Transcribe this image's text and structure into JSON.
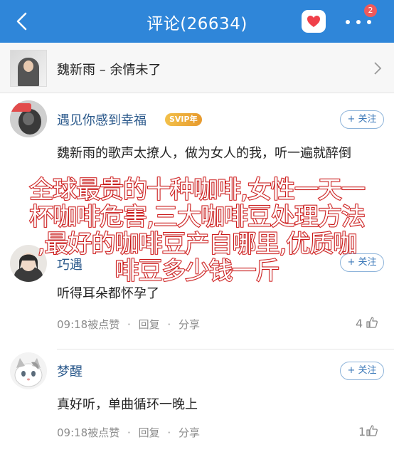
{
  "header": {
    "title": "评论(26634)",
    "notification_count": "2",
    "colors": {
      "bar": "#2f86d9",
      "badge": "#f05a5a",
      "heart": "#f0404a"
    }
  },
  "song": {
    "text": "魏新雨 – 余情未了"
  },
  "comments": [
    {
      "user": "遇见你感到幸福",
      "vip_badge": "SVIP年",
      "follow_label": "+ 关注",
      "text": "魏新雨的歌声太撩人，做为女人的我，听一遍就醉倒"
    },
    {
      "user": "巧遇",
      "follow_label": "+ 关注",
      "text": "听得耳朵都怀孕了",
      "time": "09:18被点赞",
      "reply_label": "回复",
      "share_label": "分享",
      "likes": "4"
    },
    {
      "user": "梦醒",
      "follow_label": "+ 关注",
      "text": "真好听，单曲循环一晚上",
      "time": "09:18被点赞",
      "reply_label": "回复",
      "share_label": "分享",
      "likes": "1"
    }
  ],
  "overlay": {
    "lines": [
      "全球最贵的十种咖啡,女性一天一",
      "杯咖啡危害,三大咖啡豆处理方法",
      ",最好的咖啡豆产自哪里,优质咖",
      "啡豆多少钱一斤"
    ]
  }
}
